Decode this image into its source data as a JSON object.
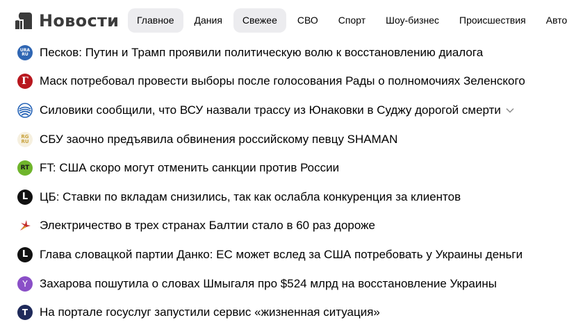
{
  "header": {
    "logo_text": "Новости",
    "tabs": [
      {
        "label": "Главное",
        "style": "pill"
      },
      {
        "label": "Дания",
        "style": "plain"
      },
      {
        "label": "Свежее",
        "style": "pill"
      },
      {
        "label": "СВО",
        "style": "plain"
      },
      {
        "label": "Спорт",
        "style": "plain"
      },
      {
        "label": "Шоу-бизнес",
        "style": "plain"
      },
      {
        "label": "Происшествия",
        "style": "plain"
      },
      {
        "label": "Авто",
        "style": "plain"
      }
    ]
  },
  "icons": {
    "ura": {
      "line1": "URA",
      "line2": "RU",
      "color": "#2f66b3"
    },
    "gazeta": {
      "letter": "Г",
      "color": "#b8171e"
    },
    "globe": {
      "color": "#1f5fb5"
    },
    "rg": {
      "line1": "RG",
      "line2": "RU",
      "color": "#c8a23c"
    },
    "rt": {
      "letter": "RT",
      "color": "#6fb52c"
    },
    "lenta": {
      "letter": "L",
      "color": "#111111"
    },
    "star": {
      "color": "#c22a2a"
    },
    "yandex": {
      "letter": "Y",
      "color": "#8a4fc7"
    },
    "tass": {
      "letter": "T",
      "color": "#1f2a5a"
    }
  },
  "news": [
    {
      "source": "ura",
      "title": "Песков: Путин и Трамп проявили политическую волю к восстановлению диалога"
    },
    {
      "source": "gazeta",
      "title": "Маск потребовал провести выборы после голосования Рады о полномочиях Зеленского"
    },
    {
      "source": "globe",
      "title": "Силовики сообщили, что ВСУ назвали трассу из Юнаковки в Суджу дорогой смерти"
    },
    {
      "source": "rg",
      "title": "СБУ заочно предъявила обвинения российскому певцу SHAMAN"
    },
    {
      "source": "rt",
      "title": "FT: США скоро могут отменить санкции против России"
    },
    {
      "source": "lenta",
      "title": "ЦБ: Ставки по вкладам снизились, так как ослабла конкуренция за клиентов"
    },
    {
      "source": "star",
      "title": "Электричество в трех странах Балтии стало в 60 раз дороже"
    },
    {
      "source": "lenta",
      "title": "Глава словацкой партии Данко: ЕС может вслед за США потребовать у Украины деньги"
    },
    {
      "source": "yandex",
      "title": "Захарова пошутила о словах Шмыгаля про $524 млрд на восстановление Украины"
    },
    {
      "source": "tass",
      "title": "На портале госуслуг запустили сервис «жизненная ситуация»"
    }
  ]
}
